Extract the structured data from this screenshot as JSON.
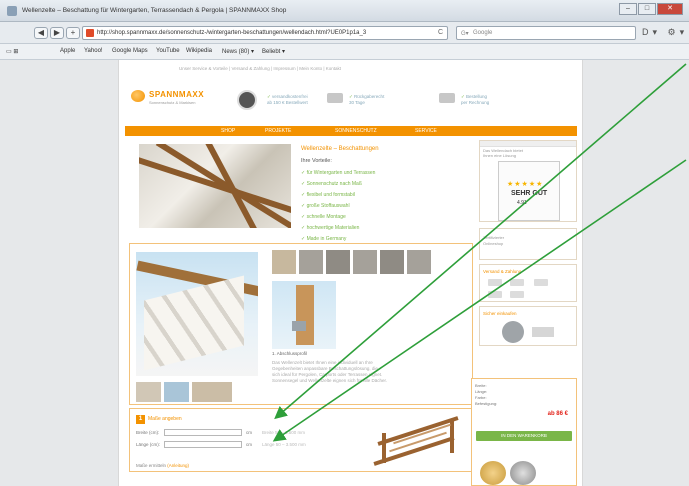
{
  "window": {
    "title": "Wellenzelte – Beschattung für Wintergarten, Terrassendach & Pergola | SPANNMAXX Shop",
    "buttons": [
      "–",
      "□",
      "✕"
    ]
  },
  "toolbar": {
    "back": "◀",
    "forward": "▶",
    "add": "+",
    "url": "http://shop.spannmaxx.de/sonnenschutz-/wintergarten-beschattungen/wellendach.html?UE0P1p1a_3",
    "reload": "C",
    "search_placeholder": "Google",
    "search_prefix": "G▾",
    "right_icons": "D▾ ⚙▾"
  },
  "bookmarks": {
    "items": [
      "▭ ⊞",
      "Apple",
      "Yahoo!",
      "Google Maps",
      "YouTube",
      "Wikipedia",
      "News (80) ▾",
      "Beliebt ▾"
    ]
  },
  "page": {
    "top_links": "Unser Service & Vorteile  |  Versand & Zahlung  |  Impressum  |  Mein Konto  |  Kontakt",
    "logo": {
      "name": "SPANNMAXX",
      "tagline": "Sonnenschutz & Markisen"
    },
    "usps": [
      {
        "check": "✓",
        "text": "versandkostenfrei",
        "sub": "ab 150 € Bestellwert"
      },
      {
        "check": "✓",
        "text": "Rückgaberecht",
        "sub": "30 Tage"
      },
      {
        "check": "✓",
        "text": "Bestellung",
        "sub": "per Rechnung"
      }
    ],
    "nav": [
      "SHOP",
      "PROJEKTE",
      "SONNENSCHUTZ",
      "SERVICE"
    ],
    "hero": {
      "title": "Wellenzelte – Beschattungen",
      "subtitle": "Ihre Vorteile:",
      "bullets": [
        "✓ für Wintergarten und Terrassen",
        "✓ Sonnenschutz nach Maß",
        "✓ flexibel und formstabil",
        "✓ große Stoffauswahl",
        "✓ schnelle Montage",
        "✓ hochwertige Materialien",
        "✓ Made in Germany"
      ]
    },
    "product": {
      "detail_caption": "1. Abschlussprofil",
      "description": [
        "Das Wellenzelt bietet Ihnen eine individuell an Ihre",
        "Gegebenheiten anpassbare Beschattungslösung, die",
        "sich ideal für Pergolen, Carports oder Terrassen eignet.",
        "Sonnensegel und Wellenzelte eignen sich für alle Dächer."
      ]
    },
    "config": {
      "step": "1",
      "title": "Maße angeben",
      "width_label": "Breite (cm):",
      "depth_label": "Länge (cm):",
      "unit": "cm",
      "width_hint": "Breite 50 – 3.500 mm",
      "depth_hint": "Länge 50 – 3.500 mm",
      "info_text": "Maße ermitteln ",
      "info_link": "(Anleitung)"
    },
    "sidebar": {
      "box1_text": [
        "Das Wellendach bietet",
        "Ihnen eine Lösung",
        "für Ihren Bedarf"
      ],
      "rating": {
        "stars": "★★★★★",
        "label": "SEHR GUT",
        "score": "4.91"
      },
      "box2_text": [
        "Zertifizierter",
        "Onlineshop"
      ],
      "shipping_title": "Versand & Zahlung",
      "security_title": "Sicher einkaufen"
    },
    "cart": {
      "labels": [
        "Breite:",
        "Länge:",
        "Farbe:",
        "Befestigung:"
      ],
      "price": "ab 86 €",
      "button": "IN DEN WARENKORB"
    }
  },
  "colors": {
    "accent": "#f39200",
    "check": "#7ab648",
    "arrow": "#2e9f3a"
  }
}
